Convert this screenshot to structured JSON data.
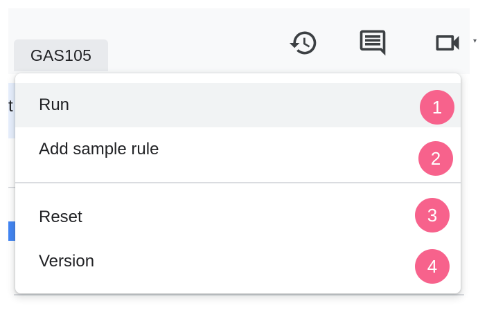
{
  "toolbar": {
    "icons": [
      "history-icon",
      "comment-icon",
      "video-icon",
      "caret-icon"
    ],
    "icon_color": "#3c4043"
  },
  "menu": {
    "trigger_label": "GAS105",
    "items": [
      {
        "label": "Run",
        "badge": "1",
        "highlighted": true
      },
      {
        "label": "Add sample rule",
        "badge": "2"
      },
      {
        "label": "Reset",
        "badge": "3"
      },
      {
        "label": "Version",
        "badge": "4"
      }
    ]
  },
  "background": {
    "partial_text": "t"
  },
  "colors": {
    "badge": "#f7628c",
    "hover": "#f1f3f4",
    "tab": "#e8eaed"
  }
}
